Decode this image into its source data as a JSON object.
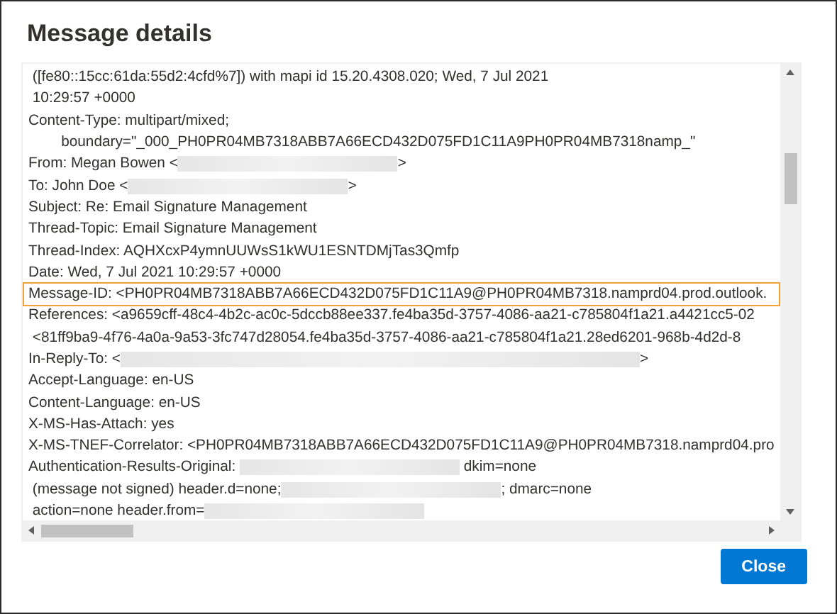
{
  "dialog": {
    "title": "Message details"
  },
  "header_lines": [
    {
      "kind": "plain",
      "segments": [
        {
          "kind": "text",
          "text": " ([fe80::15cc:61da:55d2:4cfd%7]) with mapi id 15.20.4308.020; Wed, 7 Jul 2021"
        }
      ]
    },
    {
      "kind": "plain",
      "segments": [
        {
          "kind": "text",
          "text": " 10:29:57 +0000"
        }
      ]
    },
    {
      "kind": "plain",
      "segments": [
        {
          "kind": "text",
          "text": "Content-Type: multipart/mixed;"
        }
      ]
    },
    {
      "kind": "plain",
      "segments": [
        {
          "kind": "text",
          "text": "        boundary=\"_000_PH0PR04MB7318ABB7A66ECD432D075FD1C11A9PH0PR04MB7318namp_\""
        }
      ]
    },
    {
      "kind": "plain",
      "segments": [
        {
          "kind": "text",
          "text": "From: Megan Bowen <"
        },
        {
          "kind": "redacted"
        },
        {
          "kind": "text",
          "text": ">"
        }
      ]
    },
    {
      "kind": "plain",
      "segments": [
        {
          "kind": "text",
          "text": "To: John Doe <"
        },
        {
          "kind": "redacted"
        },
        {
          "kind": "text",
          "text": ">"
        }
      ]
    },
    {
      "kind": "plain",
      "segments": [
        {
          "kind": "text",
          "text": "Subject: Re: Email Signature Management"
        }
      ]
    },
    {
      "kind": "plain",
      "segments": [
        {
          "kind": "text",
          "text": "Thread-Topic: Email Signature Management"
        }
      ]
    },
    {
      "kind": "plain",
      "segments": [
        {
          "kind": "text",
          "text": "Thread-Index: AQHXcxP4ymnUUWsS1kWU1ESNTDMjTas3Qmfp"
        }
      ]
    },
    {
      "kind": "plain",
      "segments": [
        {
          "kind": "text",
          "text": "Date: Wed, 7 Jul 2021 10:29:57 +0000"
        }
      ]
    },
    {
      "kind": "highlighted",
      "segments": [
        {
          "kind": "text",
          "text": "Message-ID: <PH0PR04MB7318ABB7A66ECD432D075FD1C11A9@PH0PR04MB7318.namprd04.prod.outlook."
        }
      ]
    },
    {
      "kind": "plain",
      "segments": [
        {
          "kind": "text",
          "text": "References: <a9659cff-48c4-4b2c-ac0c-5dccb88ee337.fe4ba35d-3757-4086-aa21-c785804f1a21.a4421cc5-02"
        }
      ]
    },
    {
      "kind": "plain",
      "segments": [
        {
          "kind": "text",
          "text": " <81ff9ba9-4f76-4a0a-9a53-3fc747d28054.fe4ba35d-3757-4086-aa21-c785804f1a21.28ed6201-968b-4d2d-8"
        }
      ]
    },
    {
      "kind": "plain",
      "segments": [
        {
          "kind": "text",
          "text": "In-Reply-To: <"
        },
        {
          "kind": "redacted-long"
        },
        {
          "kind": "text",
          "text": ">"
        }
      ]
    },
    {
      "kind": "plain",
      "segments": [
        {
          "kind": "text",
          "text": "Accept-Language: en-US"
        }
      ]
    },
    {
      "kind": "plain",
      "segments": [
        {
          "kind": "text",
          "text": "Content-Language: en-US"
        }
      ]
    },
    {
      "kind": "plain",
      "segments": [
        {
          "kind": "text",
          "text": "X-MS-Has-Attach: yes"
        }
      ]
    },
    {
      "kind": "plain",
      "segments": [
        {
          "kind": "text",
          "text": "X-MS-TNEF-Correlator: <PH0PR04MB7318ABB7A66ECD432D075FD1C11A9@PH0PR04MB7318.namprd04.pro"
        }
      ]
    },
    {
      "kind": "plain",
      "segments": [
        {
          "kind": "text",
          "text": "Authentication-Results-Original: "
        },
        {
          "kind": "redacted"
        },
        {
          "kind": "text",
          "text": " dkim=none"
        }
      ]
    },
    {
      "kind": "plain",
      "segments": [
        {
          "kind": "text",
          "text": " (message not signed) header.d=none;"
        },
        {
          "kind": "redacted"
        },
        {
          "kind": "text",
          "text": "; dmarc=none"
        }
      ]
    },
    {
      "kind": "plain",
      "segments": [
        {
          "kind": "text",
          "text": " action=none header.from="
        },
        {
          "kind": "redacted"
        }
      ]
    }
  ],
  "buttons": [
    {
      "label": "Close",
      "primary": true
    }
  ]
}
